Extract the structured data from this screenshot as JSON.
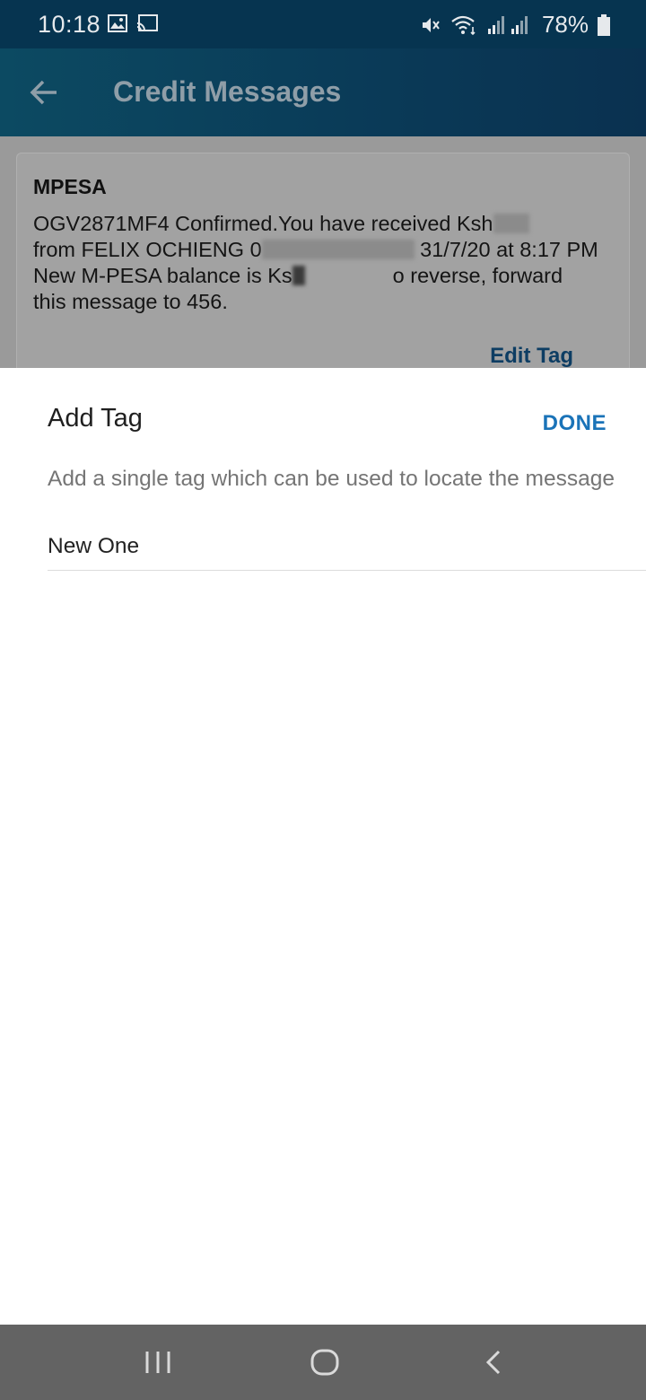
{
  "status_bar": {
    "time": "10:18",
    "battery": "78%"
  },
  "app_bar": {
    "title": "Credit Messages"
  },
  "message_card": {
    "sender": "MPESA",
    "line1_prefix": "OGV2871MF4 Confirmed.You have received Ksh",
    "line2_prefix": "from FELIX  OCHIENG 0",
    "line2_suffix": " 31/7/20 at 8:17 PM",
    "line3_prefix": "New M-PESA balance is Ks",
    "line3_suffix": "o reverse, forward",
    "line4": "this message to 456.",
    "edit_tag_label": "Edit Tag"
  },
  "dialog": {
    "title": "Add Tag",
    "done_label": "DONE",
    "subtitle": "Add a single tag which can be used to locate the message",
    "input_value": "New One"
  },
  "colors": {
    "status_bar": "#063450",
    "accent": "#1a73b8",
    "nav_bar": "#636363"
  }
}
